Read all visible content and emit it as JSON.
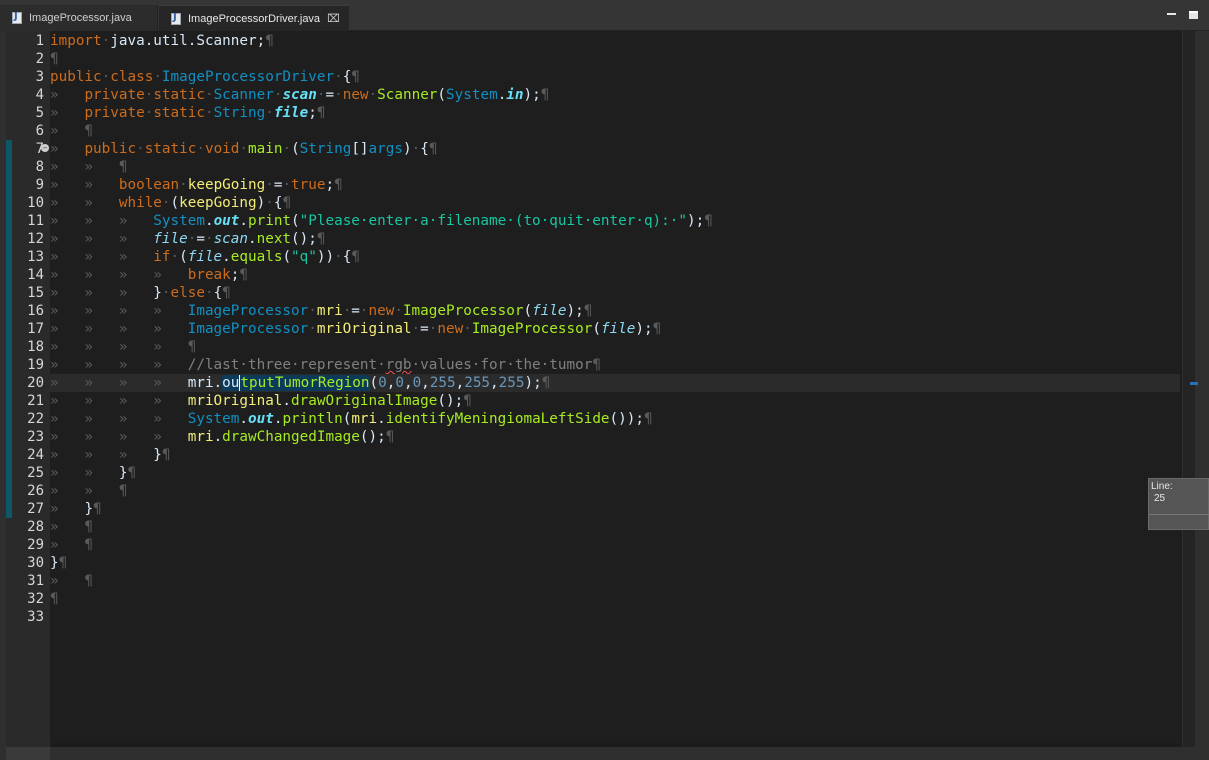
{
  "tabs": [
    {
      "label": "ImageProcessor.java",
      "active": false
    },
    {
      "label": "ImageProcessorDriver.java",
      "active": true,
      "close": "⌧"
    }
  ],
  "editor": {
    "current_line": "20",
    "line_numbers": [
      "1",
      "2",
      "3",
      "4",
      "5",
      "6",
      "7",
      "8",
      "9",
      "10",
      "11",
      "12",
      "13",
      "14",
      "15",
      "16",
      "17",
      "18",
      "19",
      "20",
      "21",
      "22",
      "23",
      "24",
      "25",
      "26",
      "27",
      "28",
      "29",
      "30",
      "31",
      "32",
      "33"
    ]
  },
  "code": {
    "import_kw": "import",
    "import_path": "java.util.Scanner;",
    "public": "public",
    "class": "class",
    "class_name": "ImageProcessorDriver",
    "private": "private",
    "static": "static",
    "void": "void",
    "new": "new",
    "boolean": "boolean",
    "while": "while",
    "if": "if",
    "else": "else",
    "break": "break",
    "true": "true",
    "Scanner": "Scanner",
    "String": "String",
    "System": "System",
    "ImageProcessor": "ImageProcessor",
    "scan": "scan",
    "file": "file",
    "in": "in",
    "out": "out",
    "main": "main",
    "args": "args",
    "keepGoing": "keepGoing",
    "mri": "mri",
    "mriOriginal": "mriOriginal",
    "print": "print",
    "println": "println",
    "next": "next",
    "equals": "equals",
    "outputTumorRegion": "outputTumorRegion",
    "drawOriginalImage": "drawOriginalImage",
    "identifyMeningiomaLeftSide": "identifyMeningiomaLeftSide",
    "drawChangedImage": "drawChangedImage",
    "prompt_string": "\"Please·enter·a·filename·(to·quit·enter·q):·\"",
    "q_string": "\"q\"",
    "comment_a": "//last·three·represent·",
    "comment_rgb": "rgb",
    "comment_b": "·values·for·the·tumor",
    "n0": "0",
    "n255": "255"
  },
  "tooltip": {
    "label": "Line:",
    "value": "25"
  },
  "colors": {
    "keyword": "#cc6c1d",
    "type": "#1290c3",
    "local_variable": "#f3ec79",
    "static_field": "#66e1f8",
    "method": "#a7ec21",
    "string": "#17c6a3",
    "comment": "#808080",
    "change_bar": "#0e5767"
  }
}
